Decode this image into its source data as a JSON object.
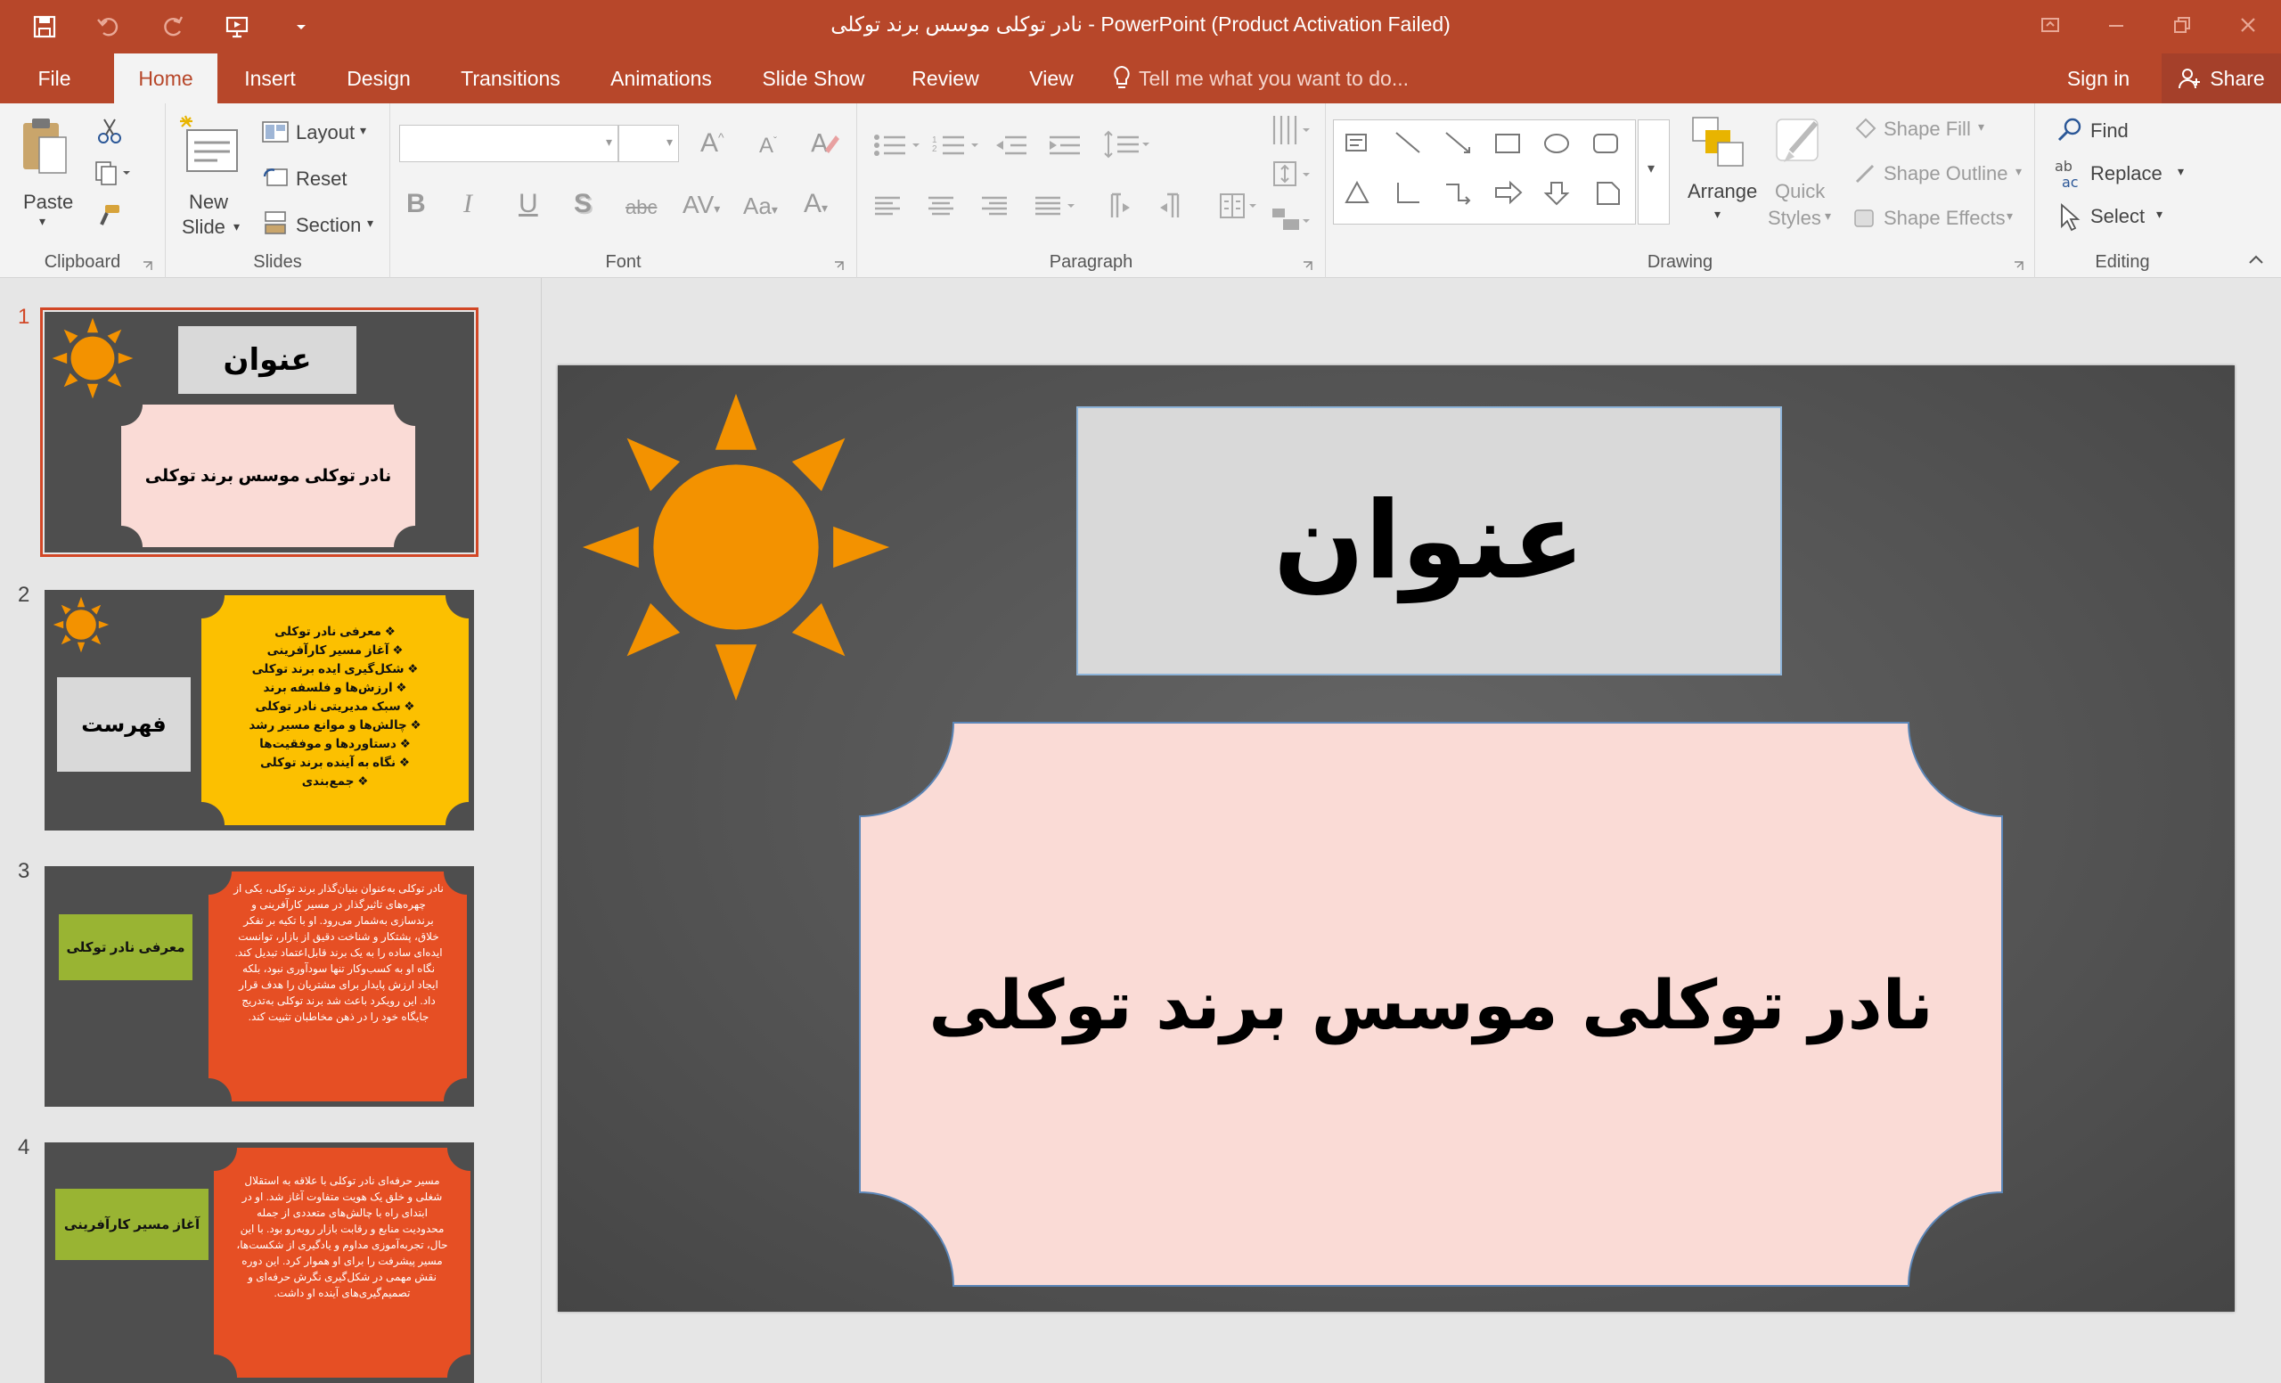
{
  "window": {
    "title": "نادر توکلی موسس برند توکلی - PowerPoint (Product Activation Failed)",
    "accent": "#b7472a"
  },
  "qat": {
    "save": "save-icon",
    "undo": "undo-icon",
    "redo": "redo-icon",
    "present": "present-icon",
    "customize": "chevron-down-icon"
  },
  "tabs": [
    "File",
    "Home",
    "Insert",
    "Design",
    "Transitions",
    "Animations",
    "Slide Show",
    "Review",
    "View"
  ],
  "tell_me": "Tell me what you want to do...",
  "sign_in": "Sign in",
  "share": "Share",
  "ribbon": {
    "clipboard": {
      "label": "Clipboard",
      "paste": "Paste"
    },
    "slides": {
      "label": "Slides",
      "new_slide_1": "New",
      "new_slide_2": "Slide",
      "layout": "Layout",
      "reset": "Reset",
      "section": "Section"
    },
    "font": {
      "label": "Font",
      "family": "",
      "size": ""
    },
    "paragraph": {
      "label": "Paragraph"
    },
    "drawing": {
      "label": "Drawing",
      "arrange": "Arrange",
      "quick_styles_1": "Quick",
      "quick_styles_2": "Styles",
      "shape_fill": "Shape Fill",
      "shape_outline": "Shape Outline",
      "shape_effects": "Shape Effects"
    },
    "editing": {
      "label": "Editing",
      "find": "Find",
      "replace": "Replace",
      "select": "Select"
    }
  },
  "slides": [
    {
      "number": "1",
      "title": "عنوان",
      "subtitle": "نادر توکلی موسس برند توکلی"
    },
    {
      "number": "2",
      "title": "فهرست",
      "items": [
        "معرفی نادر توکلی",
        "آغاز مسیر کارآفرینی",
        "شکل‌گیری ایده برند توکلی",
        "ارزش‌ها و فلسفه برند",
        "سبک مدیریتی نادر توکلی",
        "چالش‌ها و موانع مسیر رشد",
        "دستاوردها و موفقیت‌ها",
        "نگاه به آینده برند توکلی",
        "جمع‌بندی"
      ]
    },
    {
      "number": "3",
      "title": "معرفی نادر توکلی",
      "body": "نادر توکلی به‌عنوان بنیان‌گذار برند توکلی، یکی از چهره‌های تاثیرگذار در مسیر کارآفرینی و برندسازی به‌شمار می‌رود. او با تکیه بر تفکر خلاق، پشتکار و شناخت دقیق از بازار، توانست ایده‌ای ساده را به یک برند قابل‌اعتماد تبدیل کند. نگاه او به کسب‌وکار تنها سودآوری نبود، بلکه ایجاد ارزش پایدار برای مشتریان را هدف قرار داد. این رویکرد باعث شد برند توکلی به‌تدریج جایگاه خود را در ذهن مخاطبان تثبیت کند."
    },
    {
      "number": "4",
      "title": "آغاز مسیر کارآفرینی",
      "body": "مسیر حرفه‌ای نادر توکلی با علاقه به استقلال شغلی و خلق یک هویت متفاوت آغاز شد. او در ابتدای راه با چالش‌های متعددی از جمله محدودیت منابع و رقابت بازار روبه‌رو بود. با این حال، تجربه‌آموزی مداوم و یادگیری از شکست‌ها، مسیر پیشرفت را برای او هموار کرد. این دوره نقش مهمی در شکل‌گیری نگرش حرفه‌ای و تصمیم‌گیری‌های آینده او داشت."
    }
  ],
  "colors": {
    "sun": "#f39200",
    "pink": "#fadbd6",
    "yellow": "#fcc000",
    "orange": "#e64f24",
    "green": "#99b433",
    "gray_box": "#d9d9d9"
  }
}
